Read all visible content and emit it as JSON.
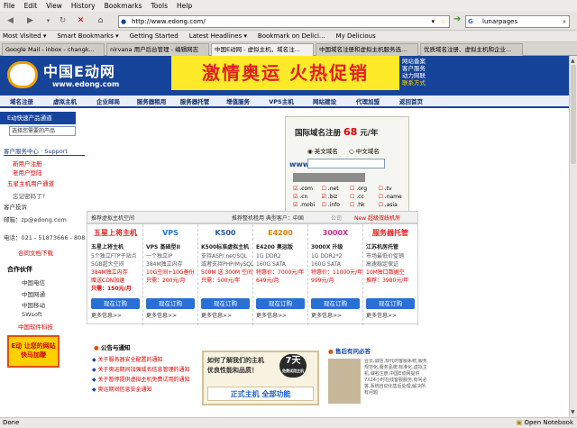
{
  "menu": [
    "File",
    "Edit",
    "View",
    "History",
    "Bookmarks",
    "Tools",
    "Help"
  ],
  "nav": {
    "url": "http://www.edong.com/",
    "search": "lunarpages"
  },
  "bookmarks": [
    "Most Visited ▾",
    "Smart Bookmarks ▾",
    "Getting Started",
    "Latest Headlines ▾",
    "Bookmark on Delici...",
    "My Delicious"
  ],
  "tabs": [
    "Google Mail - inbox - changk...",
    "nirvana 用户后台管理 - 编辑网志",
    "中国E动网 - 虚拟主机，域名注...",
    "中国域名注册和虚拟主机服务选...",
    "优质域名注册、虚拟主机和企业..."
  ],
  "status": {
    "left": "Done",
    "right": "Open Notebook"
  },
  "site": {
    "logo_cn": "中国E动网",
    "logo_en": "www.edong.com",
    "banner": "激情奥运 火热促销",
    "header_links": [
      "网站备案",
      "客户服务",
      "动力网联",
      "联系方式"
    ],
    "nav": [
      "域名注册",
      "虚拟主机",
      "企业邮局",
      "服务器租用",
      "服务器托管",
      "增值服务",
      "VPS主机",
      "网站建设",
      "代理加盟",
      "返回首页"
    ]
  },
  "sidebar": {
    "quick": "E动快速产品通道",
    "select_placeholder": "选择您需要的产品",
    "client_title": "客户服务中心 · Support",
    "links": [
      "新用户注册",
      "老用户登陆",
      "五星主机用户通道",
      "忘记密码了?"
    ],
    "complaint": "客户投诉",
    "email": "邮箱：zp@edong.com",
    "phone": "电话：021 - 51873666 - 808",
    "contract": "合同文档下载",
    "partners_title": "合作伙伴",
    "partners": [
      "中国电信",
      "中国网通",
      "中国移动",
      "SWsoft",
      "中国软件科技"
    ],
    "promo": "E动 让您的网站 快马加鞭"
  },
  "domain": {
    "title": "国际域名注册",
    "price": "68",
    "unit": "元/年",
    "opt_en": "英文域名",
    "opt_cn": "中文域名",
    "prefix": "www.",
    "tlds": [
      ".com",
      ".net",
      ".org",
      ".tv",
      ".cn",
      ".biz",
      ".cc",
      ".name",
      ".mobi",
      ".info",
      ".hk",
      ".asia"
    ]
  },
  "hosting": {
    "tabs": [
      "推荐虚拟主机空间",
      "推荐整机租用 典型客户：中国",
      "公司",
      "New 超级双线机房"
    ],
    "cols": [
      {
        "badge": "五星上将主机",
        "name": "五星上将主机",
        "lines": [
          "5个独立FTP子站点",
          "5GB超大空间",
          "384M独立内存",
          "赠送CDN加速"
        ],
        "price": "只需：150元/月"
      },
      {
        "badge": "VPS",
        "name": "VPS 基础型II",
        "lines": [
          "一个独立IP",
          "384M独立内存",
          "10G空间+10G备份",
          "只需：200元/月"
        ],
        "price": ""
      },
      {
        "badge": "K500",
        "name": "K500标准虚拟主机",
        "lines": [
          "支持ASP/.net/SQL",
          "或者支持PHP/MySQL",
          "500M 送 300M 空间",
          "只需：500元/年"
        ],
        "price": ""
      },
      {
        "badge": "E4200",
        "name": "E4200 奥运版",
        "lines": [
          "1G DDR2",
          "160G SATA",
          "特惠价：7000元/年",
          "649元/月"
        ],
        "price": ""
      },
      {
        "badge": "3000X",
        "name": "3000X 升级",
        "lines": [
          "1G DDR2*2",
          "160G SATA",
          "特惠价：11000元/年",
          "999元/月"
        ],
        "price": ""
      },
      {
        "badge": "服务器托管",
        "name": "江苏机房托管",
        "lines": [
          "市场最低价促销",
          "高速稳定保证",
          "10M独口数据空",
          "推荐：3980元/年"
        ],
        "price": ""
      }
    ],
    "order": "现在订购",
    "more": "更多信息>>"
  },
  "notices": {
    "title": "公告与通知",
    "items": [
      "关于服务器安全配置的通知",
      "关于奥运期间加强域名信息管理的通知",
      "关于暂停提供虚拟主机免费试用的通知",
      "奥运期间信息安全通知"
    ]
  },
  "ad": {
    "line1": "如何了解我们的主机",
    "line2": "优良性能和品质！",
    "badge": "7天",
    "badge2": "免费试用主机",
    "bottom": "正式主机  全部功能"
  },
  "news": {
    "title": "售后有问必答",
    "text": "合云,诚信,现代的客服系统,服务规范化,服务品牌,标准化,虚拟主机,域名注册,中国E动网提供7X24小时在线客服服务,有问必答,系统自动化售后处理,解决所有问题"
  },
  "colors": {
    "brand": "#16449a",
    "banner_bg": "#ffea2a",
    "banner_text": "#e02020",
    "price_red": "#e00000"
  }
}
